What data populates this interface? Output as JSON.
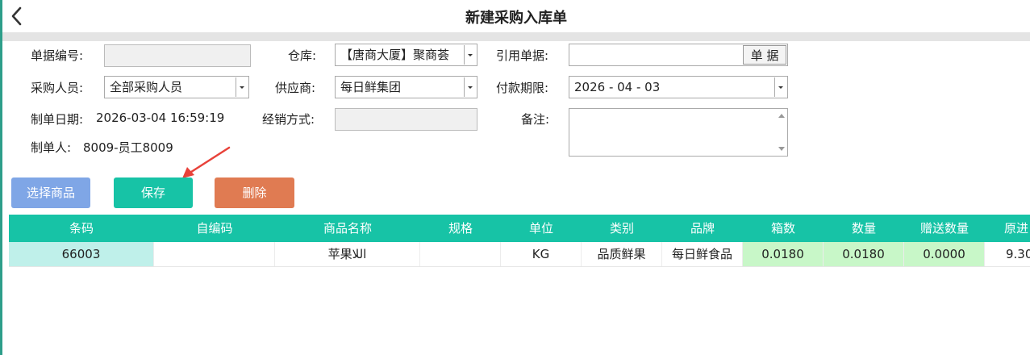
{
  "header": {
    "title": "新建采购入库单",
    "back_icon": "chevron-left-icon"
  },
  "form": {
    "doc_no": {
      "label": "单据编号:",
      "value": ""
    },
    "warehouse": {
      "label": "仓库:",
      "value": "【唐商大厦】聚商荟"
    },
    "ref_doc": {
      "label": "引用单据:",
      "value": "",
      "button": "单 据"
    },
    "buyer": {
      "label": "采购人员:",
      "value": "全部采购人员"
    },
    "supplier": {
      "label": "供应商:",
      "value": "每日鲜集团"
    },
    "pay_deadline": {
      "label": "付款期限:",
      "value": "2026 - 04 - 03"
    },
    "create_date": {
      "label": "制单日期:",
      "value": "2026-03-04 16:59:19"
    },
    "sale_mode": {
      "label": "经销方式:",
      "value": ""
    },
    "remark": {
      "label": "备注:",
      "value": ""
    },
    "creator": {
      "label": "制单人:",
      "value": "8009-员工8009"
    }
  },
  "actions": {
    "select_goods": "选择商品",
    "save": "保存",
    "delete": "删除"
  },
  "colors": {
    "select_goods": "#7fa6e6",
    "save": "#17c3a6",
    "delete": "#e07b52",
    "header_bg": "#17c3a6",
    "arrow": "#e8423a"
  },
  "table": {
    "columns": [
      "条码",
      "自编码",
      "商品名称",
      "规格",
      "单位",
      "类别",
      "品牌",
      "箱数",
      "数量",
      "赠送数量",
      "原进"
    ],
    "rows": [
      {
        "barcode": "66003",
        "self_code": "",
        "name": "苹果اللا",
        "spec": "",
        "unit": "KG",
        "category": "品质鲜果",
        "brand": "每日鲜食品",
        "boxes": "0.0180",
        "qty": "0.0180",
        "gift_qty": "0.0000",
        "orig_price": "9.30"
      }
    ]
  }
}
